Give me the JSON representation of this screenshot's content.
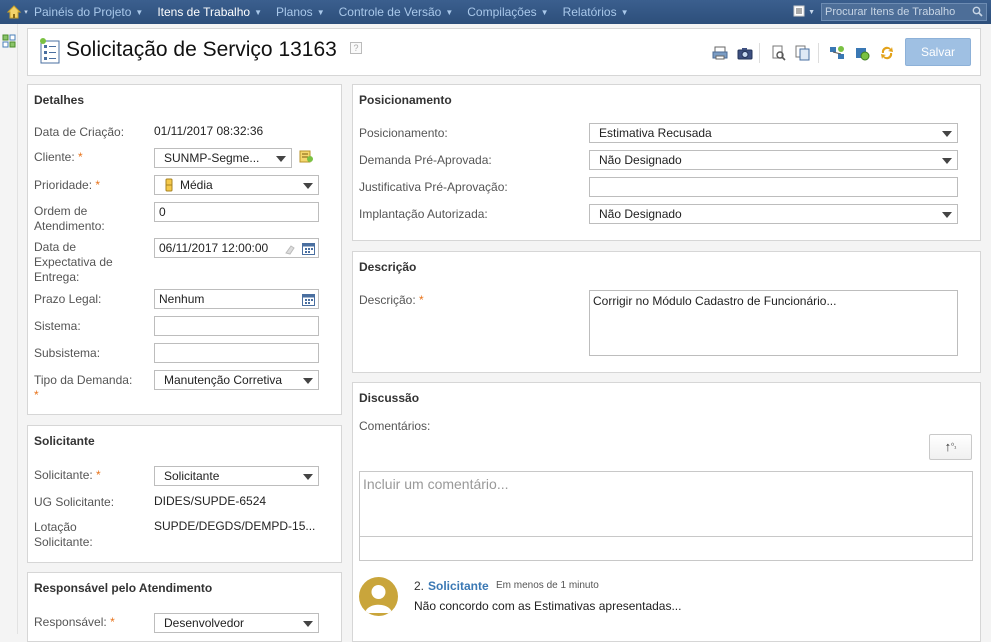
{
  "nav": {
    "items": [
      {
        "label": "Painéis do Projeto",
        "active": false
      },
      {
        "label": "Itens de Trabalho",
        "active": true
      },
      {
        "label": "Planos",
        "active": false
      },
      {
        "label": "Controle de Versão",
        "active": false
      },
      {
        "label": "Compilações",
        "active": false
      },
      {
        "label": "Relatórios",
        "active": false
      }
    ],
    "search_placeholder": "Procurar Itens de Trabalho"
  },
  "header": {
    "title": "Solicitação de Serviço 13163",
    "help": "?",
    "save_label": "Salvar"
  },
  "detalhes": {
    "title": "Detalhes",
    "data_criacao_label": "Data de Criação:",
    "data_criacao_value": "01/11/2017 08:32:36",
    "cliente_label": "Cliente:",
    "cliente_value": "SUNMP-Segme...",
    "prioridade_label": "Prioridade:",
    "prioridade_value": "Média",
    "ordem_label_1": "Ordem de",
    "ordem_label_2": "Atendimento:",
    "ordem_value": "0",
    "expectativa_label_1": "Data de",
    "expectativa_label_2": "Expectativa de",
    "expectativa_label_3": "Entrega:",
    "expectativa_value": "06/11/2017 12:00:00",
    "prazo_label": "Prazo Legal:",
    "prazo_value": "Nenhum",
    "sistema_label": "Sistema:",
    "sistema_value": "",
    "subsistema_label": "Subsistema:",
    "subsistema_value": "",
    "tipo_label": "Tipo da Demanda:",
    "tipo_value": "Manutenção Corretiva",
    "required_mark": "*"
  },
  "solicitante": {
    "title": "Solicitante",
    "solicitante_label": "Solicitante:",
    "solicitante_value": "Solicitante",
    "ug_label": "UG Solicitante:",
    "ug_value": "DIDES/SUPDE-6524",
    "lotacao_label_1": "Lotação",
    "lotacao_label_2": "Solicitante:",
    "lotacao_value": "SUPDE/DEGDS/DEMPD-15..."
  },
  "responsavel": {
    "title": "Responsável pelo Atendimento",
    "responsavel_label": "Responsável:",
    "responsavel_value": "Desenvolvedor"
  },
  "posicionamento": {
    "title": "Posicionamento",
    "posicionamento_label": "Posicionamento:",
    "posicionamento_value": "Estimativa Recusada",
    "demanda_label": "Demanda Pré-Aprovada:",
    "demanda_value": "Não Designado",
    "justificativa_label": "Justificativa Pré-Aprovação:",
    "justificativa_value": "",
    "implantacao_label": "Implantação Autorizada:",
    "implantacao_value": "Não Designado"
  },
  "descricao": {
    "title": "Descrição",
    "descricao_label": "Descrição:",
    "descricao_value": "Corrigir no Módulo Cadastro de Funcionário..."
  },
  "discussao": {
    "title": "Discussão",
    "comentarios_label": "Comentários:",
    "sort_label": "↑",
    "comment_placeholder": "Incluir um comentário...",
    "comments": [
      {
        "num": "2.",
        "author": "Solicitante",
        "time": "Em menos de 1 minuto",
        "text": "Não concordo com as Estimativas apresentadas..."
      }
    ]
  }
}
